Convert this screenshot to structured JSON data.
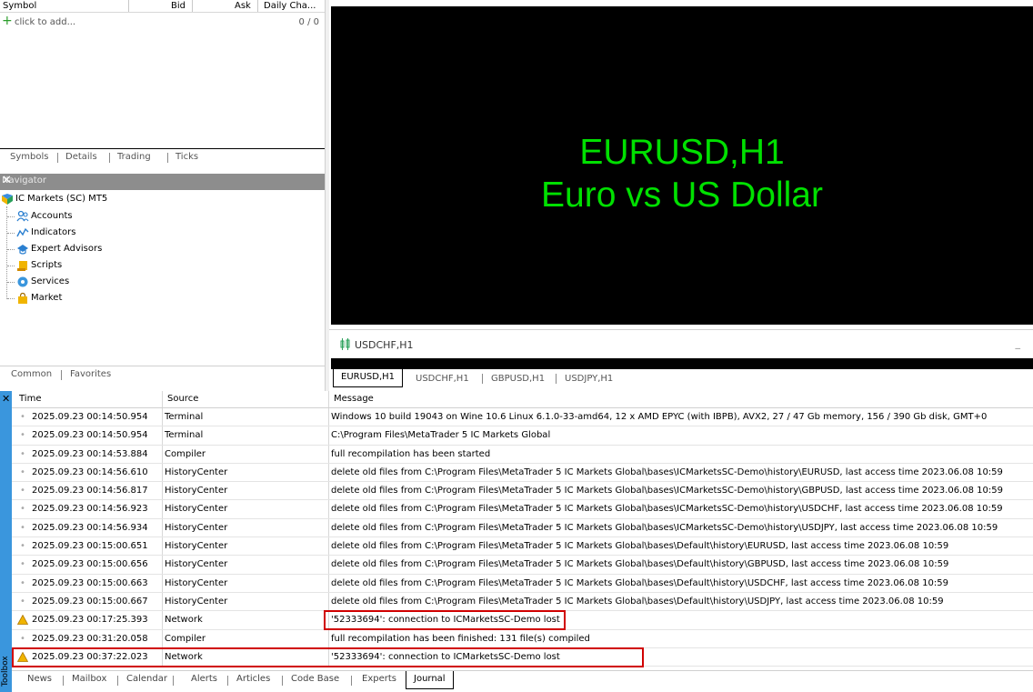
{
  "market_watch": {
    "columns": [
      "Symbol",
      "Bid",
      "Ask",
      "Daily Cha..."
    ],
    "add_text": "click to add...",
    "count": "0 / 0",
    "tabs": [
      "Symbols",
      "Details",
      "Trading",
      "Ticks"
    ]
  },
  "navigator": {
    "title": "Navigator",
    "root": "IC Markets (SC) MT5",
    "items": [
      "Accounts",
      "Indicators",
      "Expert Advisors",
      "Scripts",
      "Services",
      "Market"
    ],
    "tabs": [
      "Common",
      "Favorites"
    ]
  },
  "chart": {
    "symbol_line": "EURUSD,H1",
    "description": "Euro vs US Dollar",
    "title_color": "#00e000",
    "second_chart_label": "USDCHF,H1",
    "tabs": [
      "EURUSD,H1",
      "USDCHF,H1",
      "GBPUSD,H1",
      "USDJPY,H1"
    ]
  },
  "toolbox": {
    "label": "Toolbox",
    "columns": [
      "Time",
      "Source",
      "Message"
    ],
    "rows": [
      {
        "time": "2025.09.23 00:14:50.954",
        "source": "Terminal",
        "message": "Windows 10 build 19043 on Wine 10.6 Linux 6.1.0-33-amd64, 12 x AMD EPYC (with IBPB), AVX2, 27 / 47 Gb memory, 156 / 390 Gb disk, GMT+0",
        "level": "info"
      },
      {
        "time": "2025.09.23 00:14:50.954",
        "source": "Terminal",
        "message": "C:\\Program Files\\MetaTrader 5 IC Markets Global",
        "level": "info"
      },
      {
        "time": "2025.09.23 00:14:53.884",
        "source": "Compiler",
        "message": "full recompilation has been started",
        "level": "info"
      },
      {
        "time": "2025.09.23 00:14:56.610",
        "source": "HistoryCenter",
        "message": "delete old files from C:\\Program Files\\MetaTrader 5 IC Markets Global\\bases\\ICMarketsSC-Demo\\history\\EURUSD, last access time 2023.06.08 10:59",
        "level": "info"
      },
      {
        "time": "2025.09.23 00:14:56.817",
        "source": "HistoryCenter",
        "message": "delete old files from C:\\Program Files\\MetaTrader 5 IC Markets Global\\bases\\ICMarketsSC-Demo\\history\\GBPUSD, last access time 2023.06.08 10:59",
        "level": "info"
      },
      {
        "time": "2025.09.23 00:14:56.923",
        "source": "HistoryCenter",
        "message": "delete old files from C:\\Program Files\\MetaTrader 5 IC Markets Global\\bases\\ICMarketsSC-Demo\\history\\USDCHF, last access time 2023.06.08 10:59",
        "level": "info"
      },
      {
        "time": "2025.09.23 00:14:56.934",
        "source": "HistoryCenter",
        "message": "delete old files from C:\\Program Files\\MetaTrader 5 IC Markets Global\\bases\\ICMarketsSC-Demo\\history\\USDJPY, last access time 2023.06.08 10:59",
        "level": "info"
      },
      {
        "time": "2025.09.23 00:15:00.651",
        "source": "HistoryCenter",
        "message": "delete old files from C:\\Program Files\\MetaTrader 5 IC Markets Global\\bases\\Default\\history\\EURUSD, last access time 2023.06.08 10:59",
        "level": "info"
      },
      {
        "time": "2025.09.23 00:15:00.656",
        "source": "HistoryCenter",
        "message": "delete old files from C:\\Program Files\\MetaTrader 5 IC Markets Global\\bases\\Default\\history\\GBPUSD, last access time 2023.06.08 10:59",
        "level": "info"
      },
      {
        "time": "2025.09.23 00:15:00.663",
        "source": "HistoryCenter",
        "message": "delete old files from C:\\Program Files\\MetaTrader 5 IC Markets Global\\bases\\Default\\history\\USDCHF, last access time 2023.06.08 10:59",
        "level": "info"
      },
      {
        "time": "2025.09.23 00:15:00.667",
        "source": "HistoryCenter",
        "message": "delete old files from C:\\Program Files\\MetaTrader 5 IC Markets Global\\bases\\Default\\history\\USDJPY, last access time 2023.06.08 10:59",
        "level": "info"
      },
      {
        "time": "2025.09.23 00:17:25.393",
        "source": "Network",
        "message": "'52333694': connection to ICMarketsSC-Demo lost",
        "level": "warning"
      },
      {
        "time": "2025.09.23 00:31:20.058",
        "source": "Compiler",
        "message": "full recompilation has been finished:  131 file(s) compiled",
        "level": "info"
      },
      {
        "time": "2025.09.23 00:37:22.023",
        "source": "Network",
        "message": "'52333694': connection to ICMarketsSC-Demo lost",
        "level": "warning"
      }
    ],
    "tabs": [
      "News",
      "Mailbox",
      "Calendar",
      "Alerts",
      "Articles",
      "Code Base",
      "Experts",
      "Journal"
    ],
    "active_tab": "Journal",
    "accent_color": "#3a96dd",
    "highlight_color": "#d00000"
  }
}
